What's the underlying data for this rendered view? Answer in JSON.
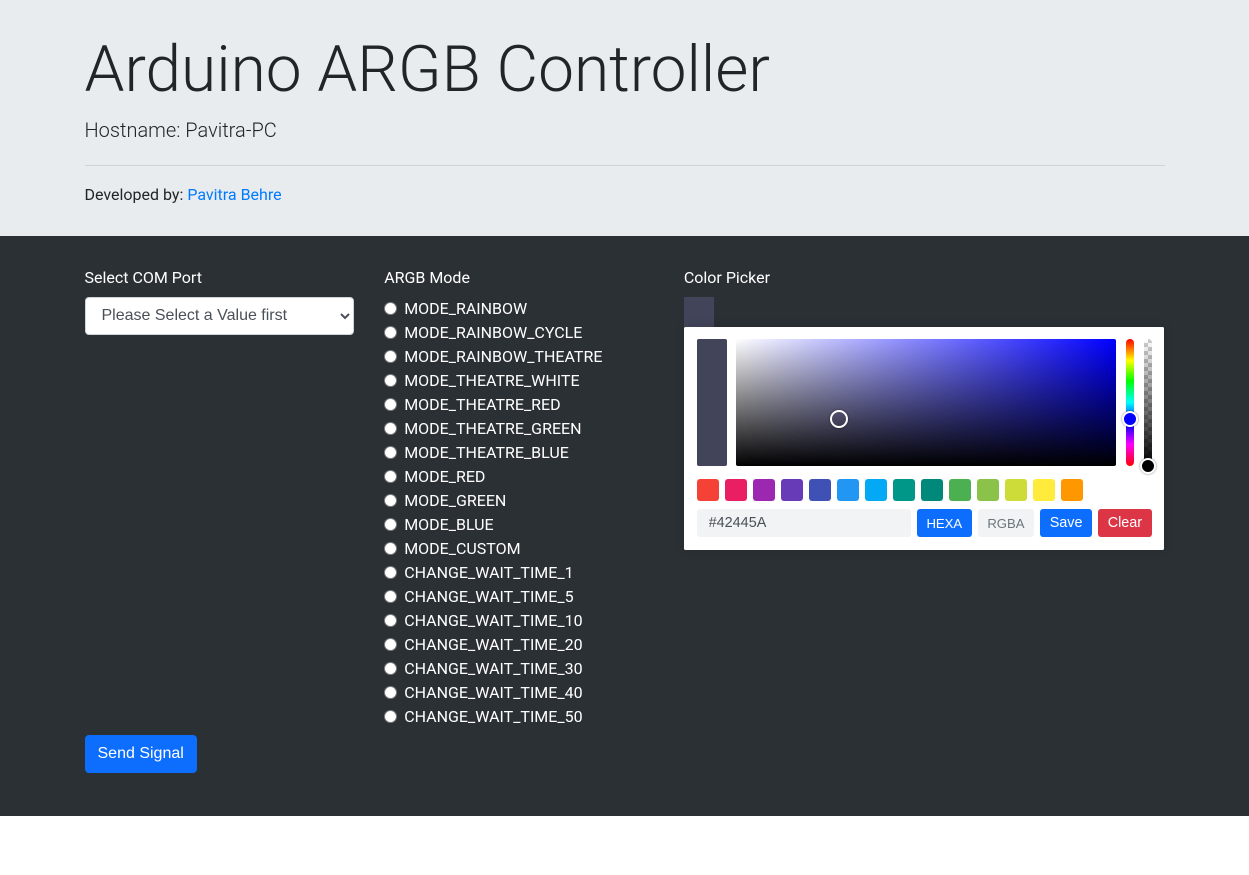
{
  "header": {
    "title": "Arduino ARGB Controller",
    "hostname_label": "Hostname: Pavitra-PC",
    "dev_prefix": "Developed by: ",
    "dev_name": "Pavitra Behre"
  },
  "comport": {
    "label": "Select COM Port",
    "placeholder": "Please Select a Value first"
  },
  "modes": {
    "label": "ARGB Mode",
    "options": [
      "MODE_RAINBOW",
      "MODE_RAINBOW_CYCLE",
      "MODE_RAINBOW_THEATRE",
      "MODE_THEATRE_WHITE",
      "MODE_THEATRE_RED",
      "MODE_THEATRE_GREEN",
      "MODE_THEATRE_BLUE",
      "MODE_RED",
      "MODE_GREEN",
      "MODE_BLUE",
      "MODE_CUSTOM",
      "CHANGE_WAIT_TIME_1",
      "CHANGE_WAIT_TIME_5",
      "CHANGE_WAIT_TIME_10",
      "CHANGE_WAIT_TIME_20",
      "CHANGE_WAIT_TIME_30",
      "CHANGE_WAIT_TIME_40",
      "CHANGE_WAIT_TIME_50"
    ]
  },
  "picker": {
    "label": "Color Picker",
    "result": "#42445A",
    "hexa_label": "HEXA",
    "rgba_label": "RGBA",
    "save_label": "Save",
    "clear_label": "Clear",
    "swatches": [
      "#f44336",
      "#e91e63",
      "#9c27b0",
      "#673ab7",
      "#3f51b5",
      "#2196f3",
      "#03a9f4",
      "#009688",
      "#00887a",
      "#4caf50",
      "#8bc34a",
      "#cddc39",
      "#ffeb3b",
      "#ff9800"
    ]
  },
  "send_label": "Send Signal"
}
